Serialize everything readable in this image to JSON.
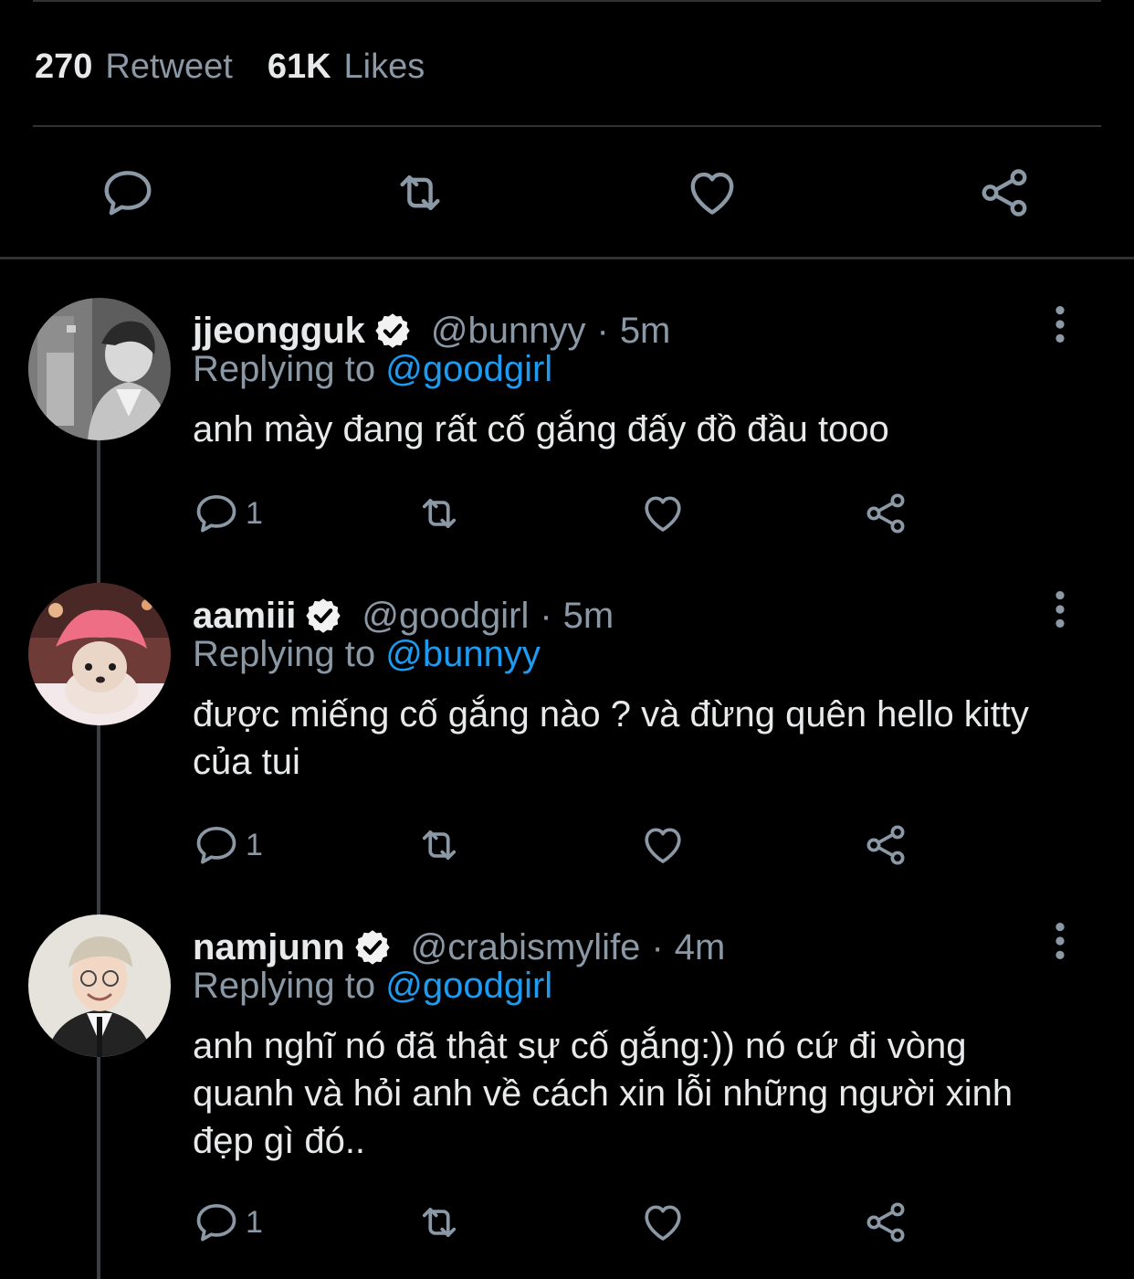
{
  "stats": {
    "retweets": {
      "count": "270",
      "label": "Retweet"
    },
    "likes": {
      "count": "61K",
      "label": "Likes"
    }
  },
  "main_actions": [
    "reply-icon",
    "retweet-icon",
    "like-icon",
    "share-icon"
  ],
  "tweets": [
    {
      "name": "jjeongguk",
      "handle": "@bunnyy",
      "separator": "·",
      "time": "5m",
      "replying_prefix": "Replying to",
      "replying_to": "@goodgirl",
      "text": "anh mày đang rất cố gắng đấy đồ đầu tooo",
      "reply_count": "1"
    },
    {
      "name": "aamiii",
      "handle": "@goodgirl",
      "separator": "·",
      "time": "5m",
      "replying_prefix": "Replying to",
      "replying_to": "@bunnyy",
      "text": "được miếng cố gắng nào ? và đừng quên hello kitty của tui",
      "reply_count": "1"
    },
    {
      "name": "namjunn",
      "handle": "@crabismylife",
      "separator": "·",
      "time": "4m",
      "replying_prefix": "Replying to",
      "replying_to": "@goodgirl",
      "text": "anh nghĩ nó đã thật sự cố gắng:)) nó cứ đi vòng quanh và hỏi anh về cách xin lỗi những người xinh đẹp gì đó..",
      "reply_count": "1"
    }
  ],
  "colors": {
    "background": "#000000",
    "primary_text": "#e7e9ea",
    "secondary_text": "#8b98a5",
    "mention": "#1d9bf0",
    "divider": "#2f3336"
  }
}
